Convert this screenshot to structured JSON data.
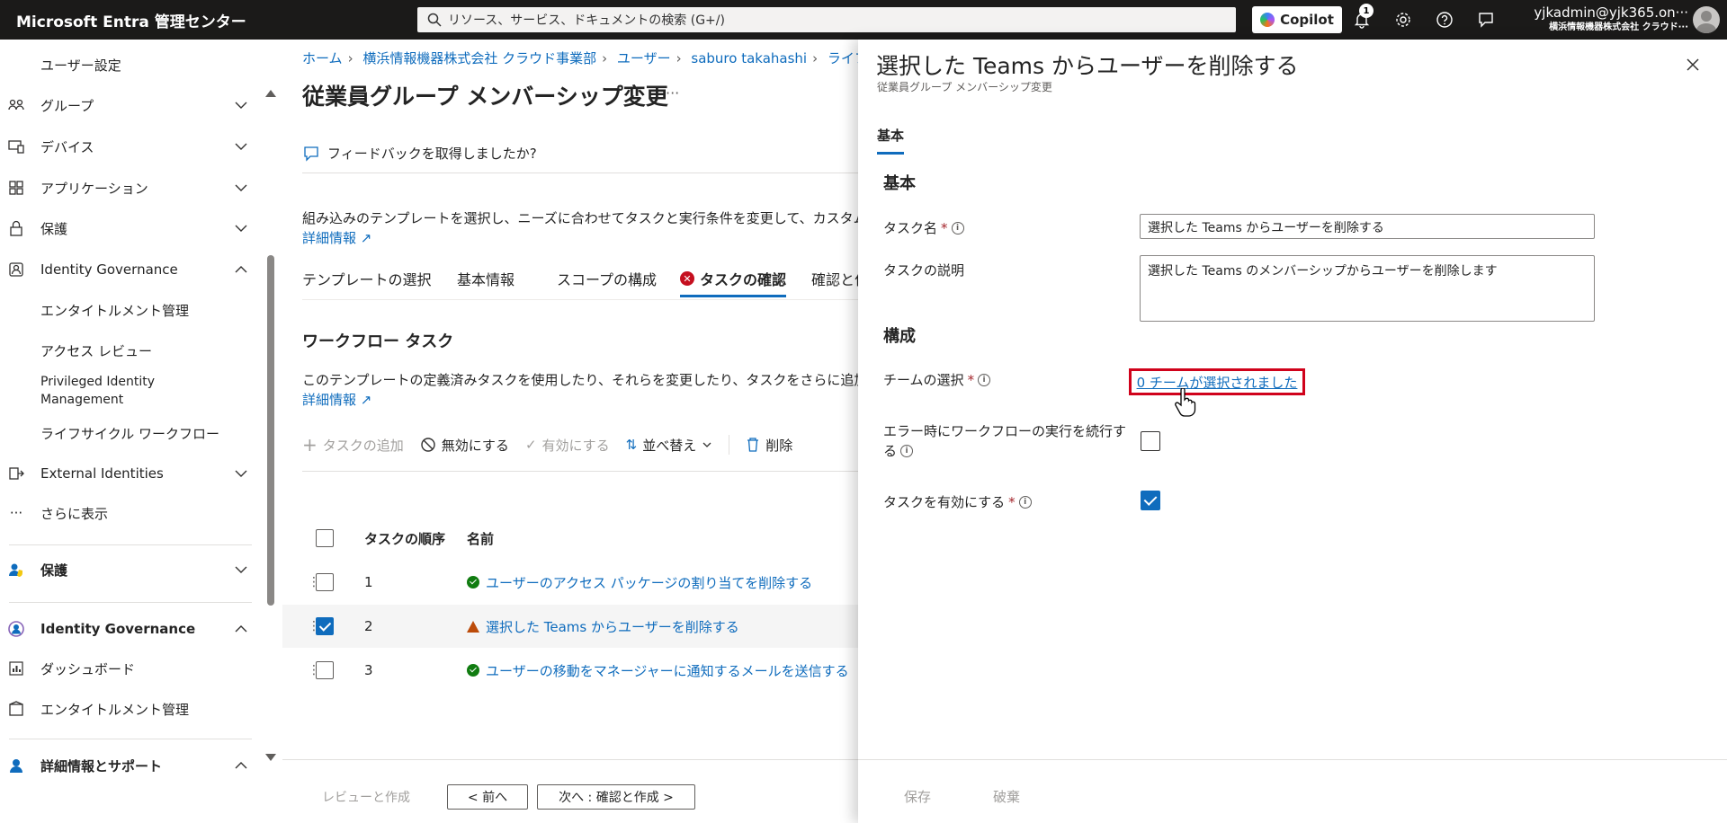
{
  "topbar": {
    "brand": "Microsoft Entra 管理センター",
    "search_placeholder": "リソース、サービス、ドキュメントの検索 (G+/)",
    "copilot_label": "Copilot",
    "notification_count": "1",
    "user_email": "yjkadmin@yjk365.on···",
    "user_org": "横浜情報機器株式会社 クラウド···"
  },
  "sidebar": {
    "items": [
      {
        "label": "ユーザー設定"
      },
      {
        "label": "グループ"
      },
      {
        "label": "デバイス"
      },
      {
        "label": "アプリケーション"
      },
      {
        "label": "保護"
      },
      {
        "label": "Identity Governance"
      },
      {
        "label": "エンタイトルメント管理"
      },
      {
        "label": "アクセス レビュー"
      },
      {
        "label": "Privileged Identity"
      },
      {
        "label": "Management"
      },
      {
        "label": "ライフサイクル ワークフロー"
      },
      {
        "label": "External Identities"
      },
      {
        "label": "さらに表示"
      },
      {
        "label": "保護"
      },
      {
        "label": "Identity Governance"
      },
      {
        "label": "ダッシュボード"
      },
      {
        "label": "エンタイトルメント管理"
      },
      {
        "label": "詳細情報とサポート"
      }
    ],
    "collapse": "«"
  },
  "main": {
    "breadcrumb": [
      "ホーム",
      "横浜情報機器株式会社 クラウド事業部",
      "ユーザー",
      "saburo takahashi",
      "ライフ"
    ],
    "title": "従業員グループ メンバーシップ変更",
    "ellipsis": "···",
    "feedback": "フィードバックを取得しましたか?",
    "description": "組み込みのテンプレートを選択し、ニーズに合わせてタスクと実行条件を変更して、カスタム",
    "learn_more": "詳細情報",
    "tabs": [
      "テンプレートの選択",
      "基本情報",
      "スコープの構成",
      "タスクの確認",
      "確認と作"
    ],
    "section_title": "ワークフロー タスク",
    "section_desc": "このテンプレートの定義済みタスクを使用したり、それらを変更したり、タスクをさらに追加",
    "section_learn_more": "詳細情報",
    "toolbar": {
      "add": "タスクの追加",
      "disable": "無効にする",
      "enable": "有効にする",
      "sort": "並べ替え",
      "delete": "削除"
    },
    "table": {
      "col_order": "タスクの順序",
      "col_name": "名前",
      "rows": [
        {
          "order": "1",
          "name": "ユーザーのアクセス パッケージの割り当てを削除する",
          "status": "ok"
        },
        {
          "order": "2",
          "name": "選択した Teams からユーザーを削除する",
          "status": "warning"
        },
        {
          "order": "3",
          "name": "ユーザーの移動をマネージャーに通知するメールを送信する",
          "status": "ok"
        }
      ]
    },
    "footer": {
      "review_create": "レビューと作成",
      "prev": "< 前へ",
      "next": "次へ : 確認と作成 >"
    }
  },
  "panel": {
    "title": "選択した Teams からユーザーを削除する",
    "subtitle": "従業員グループ メンバーシップ変更",
    "tab": "基本",
    "basic_heading": "基本",
    "task_name_label": "タスク名",
    "task_name_value": "選択した Teams からユーザーを削除する",
    "task_desc_label": "タスクの説明",
    "task_desc_value": "選択した Teams のメンバーシップからユーザーを削除します",
    "config_heading": "構成",
    "team_select_label": "チームの選択",
    "team_select_link": "0 チームが選択されました",
    "continue_on_error_label_1": "エラー時にワークフローの実行を続行す",
    "continue_on_error_label_2": "る",
    "enable_task_label": "タスクを有効にする",
    "required_mark": "*",
    "info_mark": "i",
    "save": "保存",
    "discard": "破棄"
  }
}
